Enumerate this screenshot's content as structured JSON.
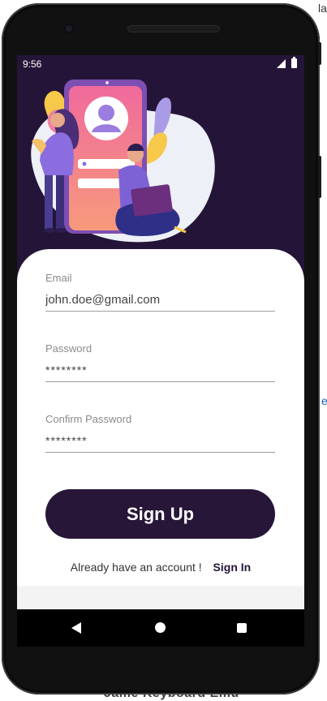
{
  "background": {
    "top_right_fragment": "la",
    "mid_right_fragment": "e",
    "bottom_fragment": "Jame Keyboard Emu"
  },
  "status_bar": {
    "time": "9:56",
    "signal_icon": "cellular-signal-icon",
    "battery_icon": "battery-icon"
  },
  "illustration": {
    "description_icon": "signup-illustration",
    "colors": {
      "background": "#241538",
      "blob": "#eef0f7",
      "phone_gradient_top": "#f16f9a",
      "phone_gradient_bottom": "#f58c7f",
      "accent_purple": "#8b6de0",
      "accent_yellow": "#f7c94a"
    }
  },
  "form": {
    "email": {
      "label": "Email",
      "value": "john.doe@gmail.com"
    },
    "password": {
      "label": "Password",
      "value": "********"
    },
    "confirm_password": {
      "label": "Confirm Password",
      "value": "********"
    }
  },
  "actions": {
    "signup_label": "Sign Up",
    "already_text": "Already have an account !",
    "signin_label": "Sign In"
  },
  "nav_bar": {
    "back_icon": "back-triangle-icon",
    "home_icon": "home-circle-icon",
    "recents_icon": "recents-square-icon"
  },
  "colors": {
    "primary": "#271638",
    "card": "#ffffff",
    "label": "#8a8a8a",
    "underline": "#9e9e9e"
  }
}
